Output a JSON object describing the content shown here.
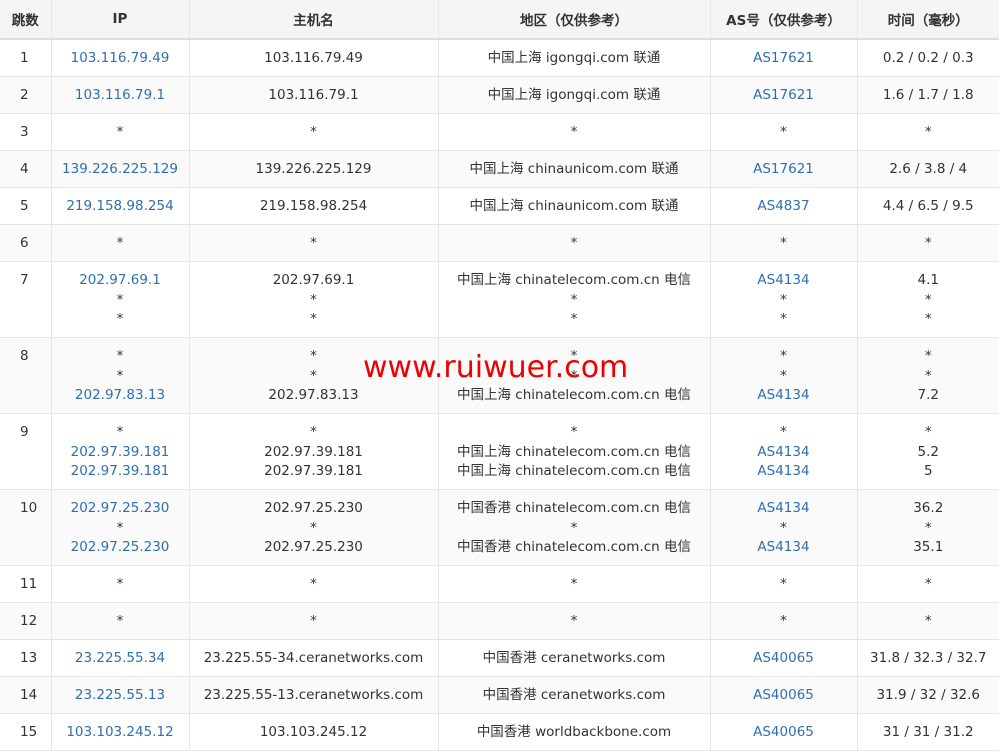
{
  "headers": [
    "跳数",
    "IP",
    "主机名",
    "地区（仅供参考）",
    "AS号（仅供参考）",
    "时间（毫秒）"
  ],
  "rows": [
    {
      "hop": "1",
      "lines": [
        [
          "103.116.79.49",
          "103.116.79.49",
          "中国上海 igongqi.com 联通",
          "AS17621",
          "0.2 / 0.2 / 0.3"
        ]
      ]
    },
    {
      "hop": "2",
      "lines": [
        [
          "103.116.79.1",
          "103.116.79.1",
          "中国上海 igongqi.com 联通",
          "AS17621",
          "1.6 / 1.7 / 1.8"
        ]
      ]
    },
    {
      "hop": "3",
      "lines": [
        [
          "*",
          "*",
          "*",
          "*",
          "*"
        ]
      ]
    },
    {
      "hop": "4",
      "lines": [
        [
          "139.226.225.129",
          "139.226.225.129",
          "中国上海 chinaunicom.com 联通",
          "AS17621",
          "2.6 / 3.8 / 4"
        ]
      ]
    },
    {
      "hop": "5",
      "lines": [
        [
          "219.158.98.254",
          "219.158.98.254",
          "中国上海 chinaunicom.com 联通",
          "AS4837",
          "4.4 / 6.5 / 9.5"
        ]
      ]
    },
    {
      "hop": "6",
      "lines": [
        [
          "*",
          "*",
          "*",
          "*",
          "*"
        ]
      ]
    },
    {
      "hop": "7",
      "lines": [
        [
          "202.97.69.1",
          "202.97.69.1",
          "中国上海 chinatelecom.com.cn 电信",
          "AS4134",
          "4.1"
        ],
        [
          "*",
          "*",
          "*",
          "*",
          "*"
        ],
        [
          "*",
          "*",
          "*",
          "*",
          "*"
        ]
      ]
    },
    {
      "hop": "8",
      "lines": [
        [
          "*",
          "*",
          "*",
          "*",
          "*"
        ],
        [
          "*",
          "*",
          "*",
          "*",
          "*"
        ],
        [
          "202.97.83.13",
          "202.97.83.13",
          "中国上海 chinatelecom.com.cn 电信",
          "AS4134",
          "7.2"
        ]
      ]
    },
    {
      "hop": "9",
      "lines": [
        [
          "*",
          "*",
          "*",
          "*",
          "*"
        ],
        [
          "202.97.39.181",
          "202.97.39.181",
          "中国上海 chinatelecom.com.cn 电信",
          "AS4134",
          "5.2"
        ],
        [
          "202.97.39.181",
          "202.97.39.181",
          "中国上海 chinatelecom.com.cn 电信",
          "AS4134",
          "5"
        ]
      ]
    },
    {
      "hop": "10",
      "lines": [
        [
          "202.97.25.230",
          "202.97.25.230",
          "中国香港 chinatelecom.com.cn 电信",
          "AS4134",
          "36.2"
        ],
        [
          "*",
          "*",
          "*",
          "*",
          "*"
        ],
        [
          "202.97.25.230",
          "202.97.25.230",
          "中国香港 chinatelecom.com.cn 电信",
          "AS4134",
          "35.1"
        ]
      ]
    },
    {
      "hop": "11",
      "lines": [
        [
          "*",
          "*",
          "*",
          "*",
          "*"
        ]
      ]
    },
    {
      "hop": "12",
      "lines": [
        [
          "*",
          "*",
          "*",
          "*",
          "*"
        ]
      ]
    },
    {
      "hop": "13",
      "lines": [
        [
          "23.225.55.34",
          "23.225.55-34.ceranetworks.com",
          "中国香港 ceranetworks.com",
          "AS40065",
          "31.8 / 32.3 / 32.7"
        ]
      ]
    },
    {
      "hop": "14",
      "lines": [
        [
          "23.225.55.13",
          "23.225.55-13.ceranetworks.com",
          "中国香港 ceranetworks.com",
          "AS40065",
          "31.9 / 32 / 32.6"
        ]
      ]
    },
    {
      "hop": "15",
      "lines": [
        [
          "103.103.245.12",
          "103.103.245.12",
          "中国香港 worldbackbone.com",
          "AS40065",
          "31 / 31 / 31.2"
        ]
      ]
    }
  ],
  "watermark": "www.ruiwuer.com",
  "colors": {
    "link": "#2f6fb0",
    "header_bg": "#f5f5f5",
    "watermark": "#ee0000"
  }
}
